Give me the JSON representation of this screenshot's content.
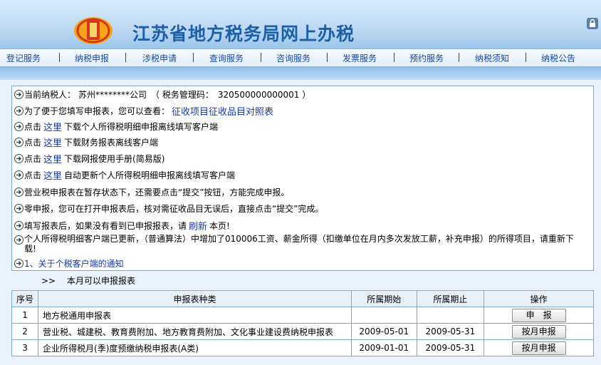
{
  "header": {
    "site_title": "江苏省地方税务局网上办税"
  },
  "nav": [
    "登记服务",
    "纳税申报",
    "涉税申请",
    "查询服务",
    "咨询服务",
    "发票服务",
    "预约服务",
    "纳税须知",
    "纳税公告"
  ],
  "info": {
    "taxpayer_label": "当前纳税人：",
    "taxpayer_name": "苏州********公司",
    "tax_code_label": "（ 税务管理码：",
    "tax_code": "320500000000001",
    "tax_code_close": "）",
    "intro_text": "为了便于您填写申报表，您可以查看：",
    "intro_link": "征收项目征收品目对照表",
    "click_prefix": "点击",
    "here_link": "这里",
    "download_1": "下载个人所得税明细申报离线填写客户端",
    "download_2": "下载财务报表离线客户端",
    "download_3": "下载网报使用手册(简易版)",
    "download_4": "自动更新个人所得税明细申报离线填写客户端",
    "note_1": "营业税申报表在暂存状态下，还需要点击“提交”按钮，方能完成申报。",
    "note_2": "零申报，您可在打开申报表后，核对需征收品目无误后，直接点击“提交”完成。",
    "refresh_prefix": "填写报表后，如果没有看到已申报报表，请",
    "refresh_link": "刷新",
    "refresh_suffix": "本页!",
    "note_3": "个人所得税明细客户端已更新，（普通算法）中增加了010006工资、薪金所得（扣缴单位在月内多次发放工薪，补充申报）的所得项目，请重新下载!",
    "notice_link": "1、关于个税客户端的通知"
  },
  "section_heading": "本月可以申报报表",
  "section_marker": ">>",
  "table": {
    "headers": [
      "序号",
      "申报表种类",
      "所属期始",
      "所属期止",
      "操作"
    ],
    "rows": [
      {
        "no": "1",
        "name": "地方税通用申报表",
        "start": "",
        "end": "",
        "action": "申　报"
      },
      {
        "no": "2",
        "name": "营业税、城建税、教育费附加、地方教育费附加、文化事业建设费纳税申报表",
        "start": "2009-05-01",
        "end": "2009-05-31",
        "action": "按月申报"
      },
      {
        "no": "3",
        "name": "企业所得税月(季)度预缴纳税申报表(A类)",
        "start": "2009-01-01",
        "end": "2009-05-31",
        "action": "按月申报"
      }
    ]
  },
  "colors": {
    "accent": "#1838a8",
    "title": "#1c5fa8",
    "border": "#7fa8d0"
  }
}
